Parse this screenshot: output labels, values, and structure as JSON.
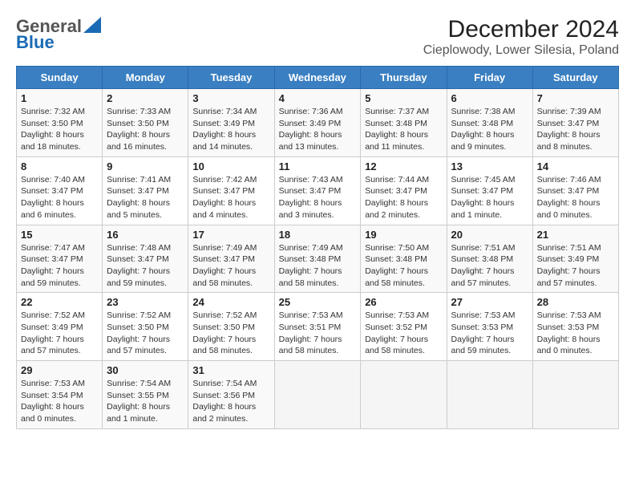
{
  "header": {
    "logo_general": "General",
    "logo_blue": "Blue",
    "title": "December 2024",
    "subtitle": "Cieplowody, Lower Silesia, Poland"
  },
  "calendar": {
    "days_of_week": [
      "Sunday",
      "Monday",
      "Tuesday",
      "Wednesday",
      "Thursday",
      "Friday",
      "Saturday"
    ],
    "weeks": [
      [
        {
          "day": "1",
          "info": "Sunrise: 7:32 AM\nSunset: 3:50 PM\nDaylight: 8 hours\nand 18 minutes."
        },
        {
          "day": "2",
          "info": "Sunrise: 7:33 AM\nSunset: 3:50 PM\nDaylight: 8 hours\nand 16 minutes."
        },
        {
          "day": "3",
          "info": "Sunrise: 7:34 AM\nSunset: 3:49 PM\nDaylight: 8 hours\nand 14 minutes."
        },
        {
          "day": "4",
          "info": "Sunrise: 7:36 AM\nSunset: 3:49 PM\nDaylight: 8 hours\nand 13 minutes."
        },
        {
          "day": "5",
          "info": "Sunrise: 7:37 AM\nSunset: 3:48 PM\nDaylight: 8 hours\nand 11 minutes."
        },
        {
          "day": "6",
          "info": "Sunrise: 7:38 AM\nSunset: 3:48 PM\nDaylight: 8 hours\nand 9 minutes."
        },
        {
          "day": "7",
          "info": "Sunrise: 7:39 AM\nSunset: 3:47 PM\nDaylight: 8 hours\nand 8 minutes."
        }
      ],
      [
        {
          "day": "8",
          "info": "Sunrise: 7:40 AM\nSunset: 3:47 PM\nDaylight: 8 hours\nand 6 minutes."
        },
        {
          "day": "9",
          "info": "Sunrise: 7:41 AM\nSunset: 3:47 PM\nDaylight: 8 hours\nand 5 minutes."
        },
        {
          "day": "10",
          "info": "Sunrise: 7:42 AM\nSunset: 3:47 PM\nDaylight: 8 hours\nand 4 minutes."
        },
        {
          "day": "11",
          "info": "Sunrise: 7:43 AM\nSunset: 3:47 PM\nDaylight: 8 hours\nand 3 minutes."
        },
        {
          "day": "12",
          "info": "Sunrise: 7:44 AM\nSunset: 3:47 PM\nDaylight: 8 hours\nand 2 minutes."
        },
        {
          "day": "13",
          "info": "Sunrise: 7:45 AM\nSunset: 3:47 PM\nDaylight: 8 hours\nand 1 minute."
        },
        {
          "day": "14",
          "info": "Sunrise: 7:46 AM\nSunset: 3:47 PM\nDaylight: 8 hours\nand 0 minutes."
        }
      ],
      [
        {
          "day": "15",
          "info": "Sunrise: 7:47 AM\nSunset: 3:47 PM\nDaylight: 7 hours\nand 59 minutes."
        },
        {
          "day": "16",
          "info": "Sunrise: 7:48 AM\nSunset: 3:47 PM\nDaylight: 7 hours\nand 59 minutes."
        },
        {
          "day": "17",
          "info": "Sunrise: 7:49 AM\nSunset: 3:47 PM\nDaylight: 7 hours\nand 58 minutes."
        },
        {
          "day": "18",
          "info": "Sunrise: 7:49 AM\nSunset: 3:48 PM\nDaylight: 7 hours\nand 58 minutes."
        },
        {
          "day": "19",
          "info": "Sunrise: 7:50 AM\nSunset: 3:48 PM\nDaylight: 7 hours\nand 58 minutes."
        },
        {
          "day": "20",
          "info": "Sunrise: 7:51 AM\nSunset: 3:48 PM\nDaylight: 7 hours\nand 57 minutes."
        },
        {
          "day": "21",
          "info": "Sunrise: 7:51 AM\nSunset: 3:49 PM\nDaylight: 7 hours\nand 57 minutes."
        }
      ],
      [
        {
          "day": "22",
          "info": "Sunrise: 7:52 AM\nSunset: 3:49 PM\nDaylight: 7 hours\nand 57 minutes."
        },
        {
          "day": "23",
          "info": "Sunrise: 7:52 AM\nSunset: 3:50 PM\nDaylight: 7 hours\nand 57 minutes."
        },
        {
          "day": "24",
          "info": "Sunrise: 7:52 AM\nSunset: 3:50 PM\nDaylight: 7 hours\nand 58 minutes."
        },
        {
          "day": "25",
          "info": "Sunrise: 7:53 AM\nSunset: 3:51 PM\nDaylight: 7 hours\nand 58 minutes."
        },
        {
          "day": "26",
          "info": "Sunrise: 7:53 AM\nSunset: 3:52 PM\nDaylight: 7 hours\nand 58 minutes."
        },
        {
          "day": "27",
          "info": "Sunrise: 7:53 AM\nSunset: 3:53 PM\nDaylight: 7 hours\nand 59 minutes."
        },
        {
          "day": "28",
          "info": "Sunrise: 7:53 AM\nSunset: 3:53 PM\nDaylight: 8 hours\nand 0 minutes."
        }
      ],
      [
        {
          "day": "29",
          "info": "Sunrise: 7:53 AM\nSunset: 3:54 PM\nDaylight: 8 hours\nand 0 minutes."
        },
        {
          "day": "30",
          "info": "Sunrise: 7:54 AM\nSunset: 3:55 PM\nDaylight: 8 hours\nand 1 minute."
        },
        {
          "day": "31",
          "info": "Sunrise: 7:54 AM\nSunset: 3:56 PM\nDaylight: 8 hours\nand 2 minutes."
        },
        {
          "day": "",
          "info": ""
        },
        {
          "day": "",
          "info": ""
        },
        {
          "day": "",
          "info": ""
        },
        {
          "day": "",
          "info": ""
        }
      ]
    ]
  }
}
